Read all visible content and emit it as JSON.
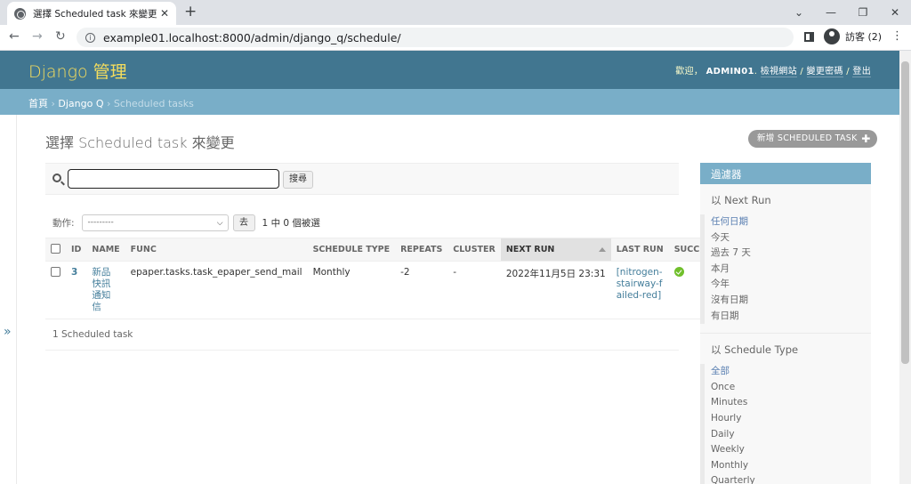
{
  "browser": {
    "tab_title": "選擇 Scheduled task 來變更 | Dj",
    "tab_close": "✕",
    "new_tab": "+",
    "url": "example01.localhost:8000/admin/django_q/schedule/",
    "profile_label": "訪客 (2)"
  },
  "header": {
    "branding": "Django 管理",
    "welcome": "歡迎，",
    "username": "ADMIN01",
    "view_site": "檢視網站",
    "change_password": "變更密碼",
    "logout": "登出"
  },
  "breadcrumbs": {
    "home": "首頁",
    "app": "Django Q",
    "current": "Scheduled tasks"
  },
  "page": {
    "title": "選擇 Scheduled task 來變更",
    "add_button": "新增 SCHEDULED TASK"
  },
  "search": {
    "value": "",
    "button": "搜尋"
  },
  "actions": {
    "label": "動作:",
    "selected": "---------",
    "go": "去",
    "counter": "1 中 0 個被選"
  },
  "table": {
    "columns": [
      "ID",
      "NAME",
      "FUNC",
      "SCHEDULE TYPE",
      "REPEATS",
      "CLUSTER",
      "NEXT RUN",
      "LAST RUN",
      "SUCCESS"
    ],
    "rows": [
      {
        "id": "3",
        "name": "新品快訊通知信",
        "func": "epaper.tasks.task_epaper_send_mail",
        "schedule_type": "Monthly",
        "repeats": "-2",
        "cluster": "-",
        "next_run": "2022年11月5日 23:31",
        "last_run": "[nitrogen-stairway-failed-red]",
        "success": true
      }
    ]
  },
  "paginator": "1 Scheduled task",
  "filter": {
    "heading": "過濾器",
    "next_run": {
      "title": "以 Next Run",
      "options": [
        "任何日期",
        "今天",
        "過去 7 天",
        "本月",
        "今年",
        "沒有日期",
        "有日期"
      ],
      "selected": 0
    },
    "schedule_type": {
      "title": "以 Schedule Type",
      "options": [
        "全部",
        "Once",
        "Minutes",
        "Hourly",
        "Daily",
        "Weekly",
        "Monthly",
        "Quarterly"
      ],
      "selected": 0
    }
  },
  "colors": {
    "header_bg": "#417690",
    "breadcrumb_bg": "#79aec8",
    "brand_text": "#f5dd5d",
    "link": "#447e9b",
    "success": "#70bf2b"
  }
}
